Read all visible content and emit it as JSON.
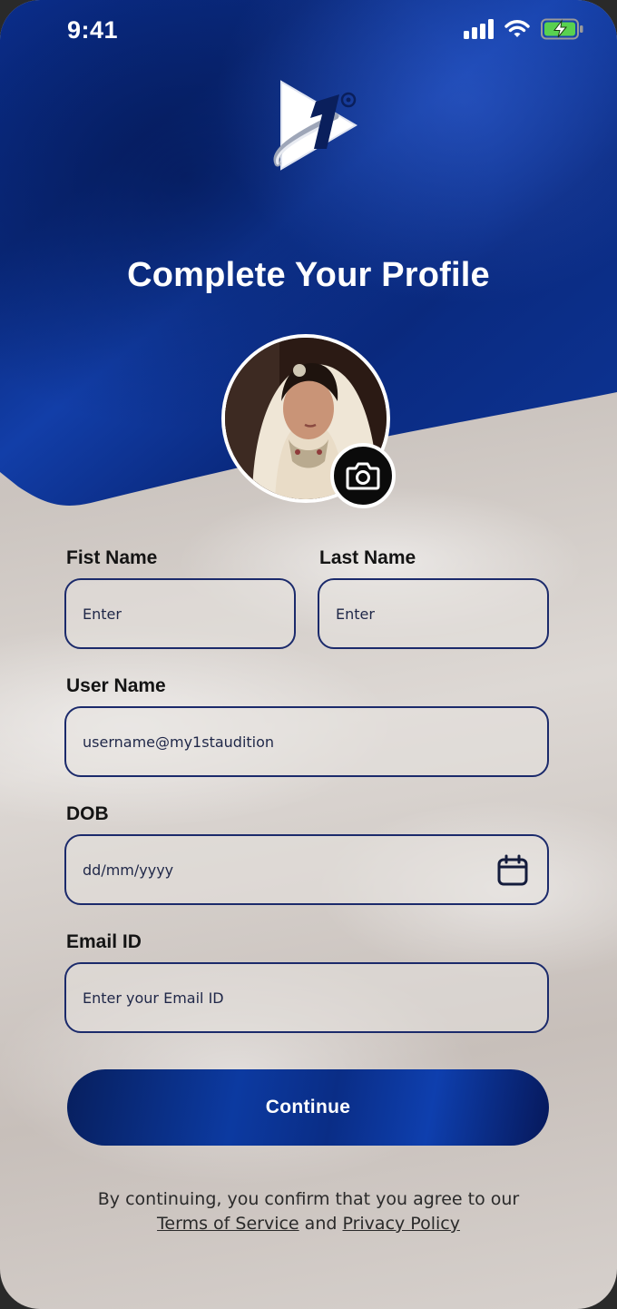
{
  "status_bar": {
    "time": "9:41"
  },
  "page": {
    "title": "Complete Your Profile"
  },
  "form": {
    "first_name": {
      "label": "Fist Name",
      "placeholder": "Enter",
      "value": ""
    },
    "last_name": {
      "label": "Last Name",
      "placeholder": "Enter",
      "value": ""
    },
    "username": {
      "label": "User Name",
      "placeholder": "username@my1staudition",
      "value": ""
    },
    "dob": {
      "label": "DOB",
      "placeholder": "dd/mm/yyyy",
      "value": ""
    },
    "email": {
      "label": "Email ID",
      "placeholder": "Enter your Email ID",
      "value": ""
    }
  },
  "actions": {
    "continue_label": "Continue"
  },
  "legal": {
    "prefix": "By continuing, you confirm that you agree to our",
    "terms": "Terms of Service",
    "and": "and",
    "privacy": "Privacy Policy"
  },
  "icons": {
    "camera": "camera-icon",
    "calendar": "calendar-icon",
    "wifi": "wifi-icon",
    "battery": "battery-charging-icon",
    "signal": "cellular-signal-icon"
  },
  "colors": {
    "brand_blue": "#0c3aa1",
    "field_border": "#1b2a6b",
    "battery_green": "#59d14f"
  }
}
